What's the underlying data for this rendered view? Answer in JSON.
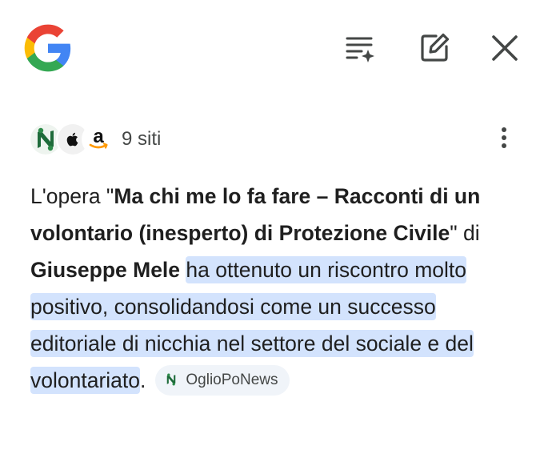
{
  "header": {
    "logo_icon": "google-g-logo",
    "actions": [
      {
        "icon": "list-sparkle-icon"
      },
      {
        "icon": "edit-icon"
      },
      {
        "icon": "close-icon"
      }
    ]
  },
  "sources": {
    "favicons": [
      "oglioponews-icon",
      "apple-icon",
      "amazon-icon"
    ],
    "count_label": "9 siti",
    "menu_icon": "more-vert-icon"
  },
  "answer": {
    "p1": "L'opera \"",
    "title": "Ma chi me lo fa fare – Racconti di un volontario (inesperto) di Protezione Civile",
    "p2": "\" di ",
    "author": "Giuseppe Mele",
    "p3": " ",
    "highlight": "ha ottenuto un riscontro molto positivo, consolidandosi come un successo editoriale di nicchia nel settore del sociale e del volontariato",
    "p4": ".",
    "citation_label": "OglioPoNews"
  },
  "colors": {
    "highlight": "#d3e3fd",
    "chip_bg": "#f0f4f9",
    "icon_gray": "#444746",
    "oglio_green": "#1e6b3a"
  }
}
